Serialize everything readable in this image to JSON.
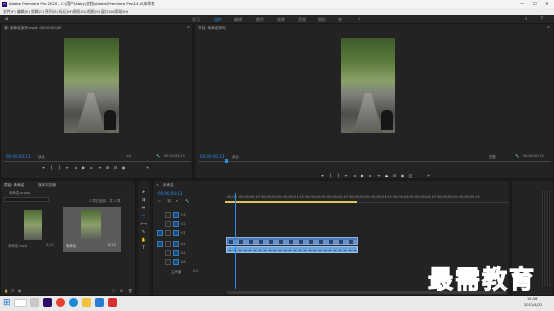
{
  "window": {
    "title": "Adobe Premiere Pro 2020 - C:\\用户\\Abby\\文档\\Adobe\\Premiere Pro\\14.0\\未命名"
  },
  "menu": {
    "items": [
      "文件(F)",
      "编辑(E)",
      "剪辑(C)",
      "序列(S)",
      "标记(M)",
      "图形(G)",
      "视图(V)",
      "窗口(W)",
      "帮助(H)"
    ]
  },
  "workspaces": {
    "items": [
      "学习",
      "组件",
      "编辑",
      "颜色",
      "效果",
      "音频",
      "图形",
      "库"
    ],
    "active": "组件"
  },
  "source_monitor": {
    "title": "源: 未命名序列.mp4: 00;00;00;00",
    "timecode": "00;00;00;13",
    "fit": "适合",
    "ratio": "1/2",
    "duration": "00;00;00;13"
  },
  "program_monitor": {
    "title": "节目: 未命名序列",
    "timecode": "00;00;00;13",
    "fit": "适合",
    "ratio": "完整",
    "duration": "00;00;00;13"
  },
  "project": {
    "tabs": [
      "项目: 未命名",
      "媒体浏览器"
    ],
    "file": "未命名.prproj",
    "count": "1 项已选择，共 2 项",
    "items": [
      {
        "name": "未命名.mp4",
        "duration": "0;13"
      },
      {
        "name": "未命名",
        "duration": "0;13"
      }
    ]
  },
  "timeline": {
    "title": "未命名",
    "timecode": "00;00;00;13",
    "ruler": [
      "00;00",
      "00;00;00;15",
      "00;00;01;00",
      "00;00;01;15",
      "00;00;02;00",
      "00;00;02;15",
      "00;00;03;00",
      "00;00;03;15",
      "00;00;04;00",
      "00;00;04;15",
      "00;00;05;00",
      "00;00;05;15"
    ],
    "video_tracks": [
      "V3",
      "V2",
      "V1"
    ],
    "audio_tracks": [
      "A1",
      "A2",
      "A3"
    ],
    "master": "主声道",
    "master_value": "0.0"
  },
  "taskbar": {
    "time": "15:36",
    "date": "2021/4/22"
  },
  "watermark": {
    "text": "最需教育"
  },
  "colors": {
    "accent": "#2d8ceb",
    "clip_video": "#4a78b8",
    "clip_audio": "#6aa0d8",
    "watermark": "#1b3fa0"
  }
}
